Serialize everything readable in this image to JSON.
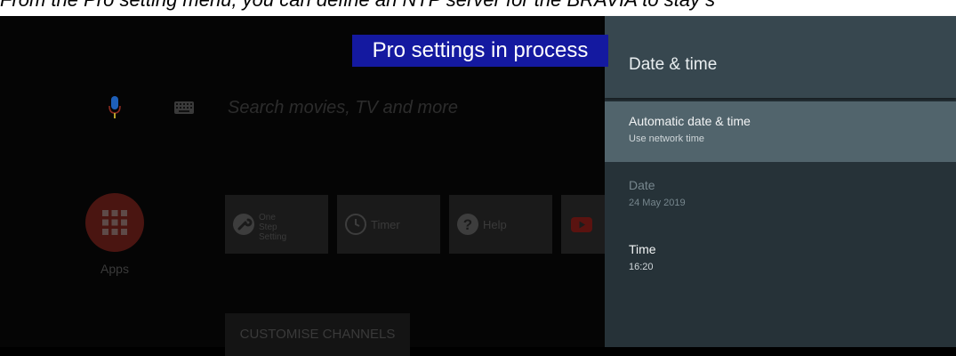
{
  "caption": {
    "text": "From the Pro setting menu, you can define an NTP server for the BRAVIA to stay s"
  },
  "banner": {
    "text": "Pro settings in process"
  },
  "home": {
    "search_placeholder": "Search movies, TV and more",
    "apps_label": "Apps",
    "tiles": [
      {
        "label": "One Step Setting",
        "icon": "wrench-icon"
      },
      {
        "label": "Timer",
        "icon": "clock-icon"
      },
      {
        "label": "Help",
        "icon": "help-icon"
      },
      {
        "label": "",
        "icon": "youtube-icon"
      }
    ],
    "customise_label": "CUSTOMISE CHANNELS"
  },
  "panel": {
    "title": "Date & time",
    "items": [
      {
        "title": "Automatic date & time",
        "subtitle": "Use network time",
        "state": "selected"
      },
      {
        "title": "Date",
        "subtitle": "24 May 2019",
        "state": "disabled"
      },
      {
        "title": "Time",
        "subtitle": "16:20",
        "state": "normal"
      }
    ]
  },
  "colors": {
    "banner_bg": "#1419a0",
    "panel_bg": "#263238",
    "panel_header_bg": "#37474f",
    "selected_item_bg": "#51646c",
    "apps_button": "#4a1511"
  }
}
